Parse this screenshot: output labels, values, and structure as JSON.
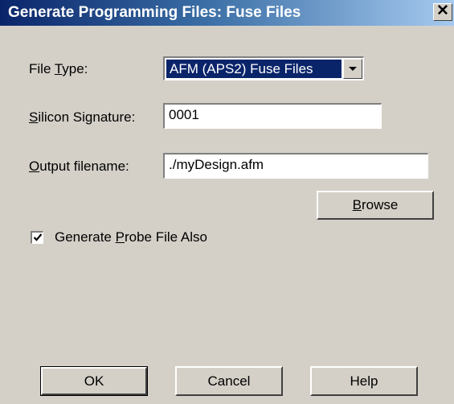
{
  "window": {
    "title": "Generate Programming Files: Fuse Files",
    "close_glyph": "✕"
  },
  "fields": {
    "file_type": {
      "label_pre": "File ",
      "label_mnemonic": "T",
      "label_post": "ype:",
      "value": "AFM (APS2) Fuse Files"
    },
    "silicon_signature": {
      "label_pre": "",
      "label_mnemonic": "S",
      "label_post": "ilicon Signature:",
      "value": "0001"
    },
    "output_filename": {
      "label_pre": "",
      "label_mnemonic": "O",
      "label_post": "utput filename:",
      "value": "./myDesign.afm"
    }
  },
  "browse_button": {
    "label_pre": "",
    "label_mnemonic": "B",
    "label_post": "rowse"
  },
  "probe_checkbox": {
    "checked": true,
    "label_pre": "Generate ",
    "label_mnemonic": "P",
    "label_post": "robe File Also"
  },
  "buttons": {
    "ok": "OK",
    "cancel": "Cancel",
    "help": "Help"
  },
  "colors": {
    "dialog_bg": "#d4d0c8",
    "titlebar_start": "#0a246a",
    "titlebar_end": "#a6caf0",
    "selection": "#0a246a"
  }
}
